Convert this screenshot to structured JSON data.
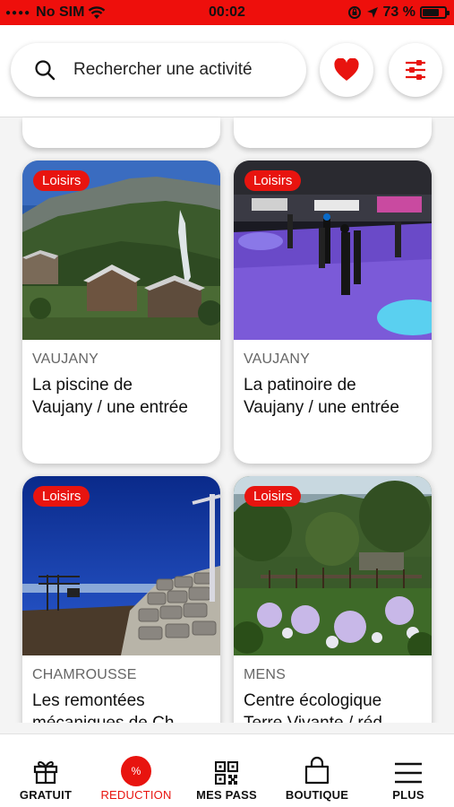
{
  "status_bar": {
    "carrier": "No SIM",
    "time": "00:02",
    "battery": "73 %",
    "battery_level": 0.73
  },
  "header": {
    "search_placeholder": "Rechercher une activité"
  },
  "cards": [
    {
      "category": "Loisirs",
      "location": "VAUJANY",
      "title_line1": "La piscine de",
      "title_line2": "Vaujany / une entrée"
    },
    {
      "category": "Loisirs",
      "location": "VAUJANY",
      "title_line1": "La patinoire de",
      "title_line2": "Vaujany / une entrée"
    },
    {
      "category": "Loisirs",
      "location": "CHAMROUSSE",
      "title_line1": "Les remontées",
      "title_line2": "mécaniques de Ch..."
    },
    {
      "category": "Loisirs",
      "location": "MENS",
      "title_line1": "Centre écologique",
      "title_line2": "Terre Vivante / réd..."
    }
  ],
  "nav": {
    "items": [
      {
        "label": "GRATUIT"
      },
      {
        "label": "REDUCTION",
        "badge": "%"
      },
      {
        "label": "MES PASS"
      },
      {
        "label": "BOUTIQUE"
      },
      {
        "label": "PLUS"
      }
    ]
  },
  "colors": {
    "accent": "#e8140f",
    "status_bar": "#ee0f0c"
  }
}
